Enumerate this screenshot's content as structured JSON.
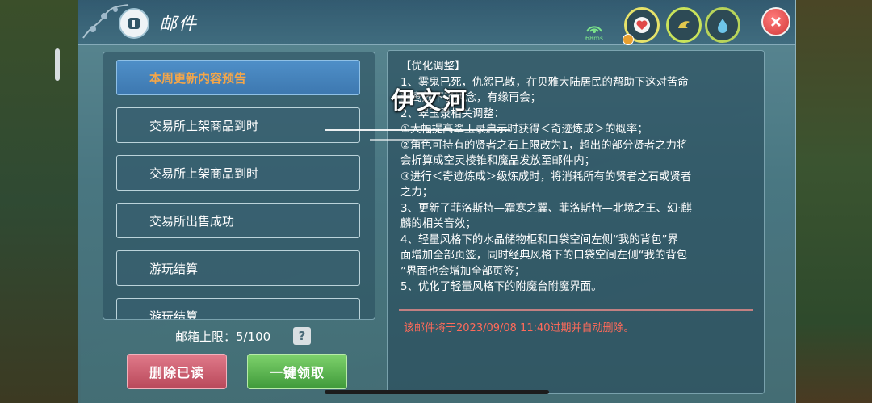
{
  "window": {
    "title": "邮件"
  },
  "hud": {
    "ping": "68ms",
    "icons": [
      "wifi-signal-icon",
      "heart-icon",
      "stamina-icon",
      "water-drop-icon",
      "close-icon"
    ],
    "colors": {
      "ping": "#7be38a",
      "heart": "#e04848",
      "close": "#d23a3a"
    }
  },
  "mail_list": {
    "items": [
      {
        "label": "本周更新内容预告",
        "selected": true
      },
      {
        "label": "交易所上架商品到时"
      },
      {
        "label": "交易所上架商品到时"
      },
      {
        "label": "交易所出售成功"
      },
      {
        "label": "游玩结算"
      },
      {
        "label": "游玩结算"
      }
    ]
  },
  "footer": {
    "limit_label": "邮箱上限：5/100",
    "help": "?",
    "delete_read": "删除已读",
    "claim_all": "一键领取"
  },
  "content": {
    "lines": [
      "【优化调整】",
      "1、雾鬼已死，仇怨已散，在贝雅大陆居民的帮助下这对苦命",
      "鸳鸯放下了执念，有缘再会；",
      "2、翠玉录相关调整：",
      "①大幅提高翠玉录启示时获得＜奇迹炼成＞的概率；",
      "②角色可持有的贤者之石上限改为1，超出的部分贤者之力将",
      "会折算成空灵棱锥和魔晶发放至邮件内；",
      "③进行＜奇迹炼成＞级炼成时，将消耗所有的贤者之石或贤者",
      "之力；",
      "3、更新了菲洛斯特—霜寒之翼、菲洛斯特—北境之王、幻·麒",
      "麟的相关音效；",
      "4、轻量风格下的水晶储物柜和口袋空间左侧“我的背包”界",
      "面增加全部页签，同时经典风格下的口袋空间左侧“我的背包",
      "”界面也会增加全部页签；",
      "5、优化了轻量风格下的附魔台附魔界面。"
    ],
    "expiry": "该邮件将于2023/09/08 11:40过期并自动删除。"
  },
  "overlay": {
    "name": "伊文河"
  }
}
